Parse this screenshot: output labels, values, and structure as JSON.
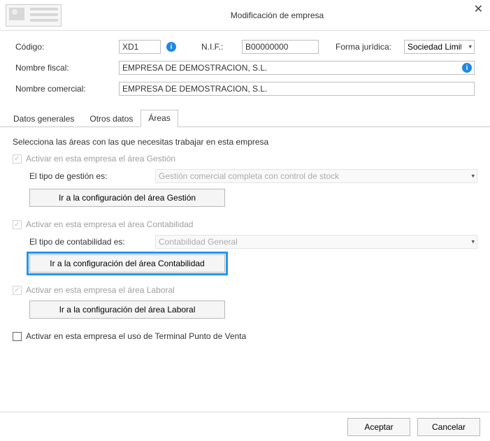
{
  "window": {
    "title": "Modificación de empresa"
  },
  "header": {
    "codigo_label": "Código:",
    "codigo_value": "XD1",
    "nif_label": "N.I.F.:",
    "nif_value": "B00000000",
    "forma_label": "Forma jurídica:",
    "forma_value": "Sociedad Limitada",
    "fiscal_label": "Nombre fiscal:",
    "fiscal_value": "EMPRESA DE DEMOSTRACION, S.L.",
    "comercial_label": "Nombre comercial:",
    "comercial_value": "EMPRESA DE DEMOSTRACION, S.L."
  },
  "tabs": {
    "general": "Datos generales",
    "otros": "Otros datos",
    "areas": "Áreas"
  },
  "areas": {
    "intro": "Selecciona las áreas con las que necesitas trabajar en esta empresa",
    "gestion": {
      "check_label": "Activar en esta empresa el área Gestión",
      "tipo_label": "El tipo de gestión es:",
      "tipo_value": "Gestión comercial completa con control de stock",
      "config_btn": "Ir a la configuración del área Gestión"
    },
    "contabilidad": {
      "check_label": "Activar en esta empresa el área Contabilidad",
      "tipo_label": "El tipo de contabilidad es:",
      "tipo_value": "Contabilidad General",
      "config_btn": "Ir a la configuración del área Contabilidad"
    },
    "laboral": {
      "check_label": "Activar en esta empresa el área Laboral",
      "config_btn": "Ir a la configuración del área Laboral"
    },
    "tpv": {
      "check_label": "Activar en esta empresa el uso de Terminal Punto de Venta"
    }
  },
  "footer": {
    "accept": "Aceptar",
    "cancel": "Cancelar"
  }
}
